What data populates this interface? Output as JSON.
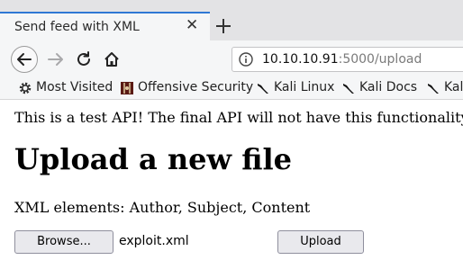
{
  "tab": {
    "title": "Send feed with XML",
    "close_icon": "close-icon",
    "new_tab_icon": "plus-icon"
  },
  "nav": {
    "back_icon": "back-arrow-icon",
    "forward_icon": "forward-arrow-icon",
    "reload_icon": "reload-icon",
    "home_icon": "home-icon",
    "url_host": "10.10.10.91",
    "url_rest": ":5000/upload",
    "info_icon": "info-icon"
  },
  "bookmarks": [
    {
      "label": "Most Visited",
      "icon": "gear-icon"
    },
    {
      "label": "Offensive Security",
      "icon": "offsec-icon"
    },
    {
      "label": "Kali Linux",
      "icon": "kali-dragon-icon"
    },
    {
      "label": "Kali Docs",
      "icon": "kali-dragon-icon"
    },
    {
      "label": "Kal",
      "icon": "kali-dragon-icon"
    }
  ],
  "page": {
    "notice": "This is a test API! The final API will not have this functionality",
    "heading": "Upload a new file",
    "xml_elements": "XML elements: Author, Subject, Content",
    "browse_label": "Browse...",
    "file_name": "exploit.xml",
    "upload_label": "Upload"
  },
  "colors": {
    "tab_accent": "#2f78d4",
    "toolbar_bg": "#f5f6f7",
    "tabstrip_bg": "#e3e3e5"
  }
}
